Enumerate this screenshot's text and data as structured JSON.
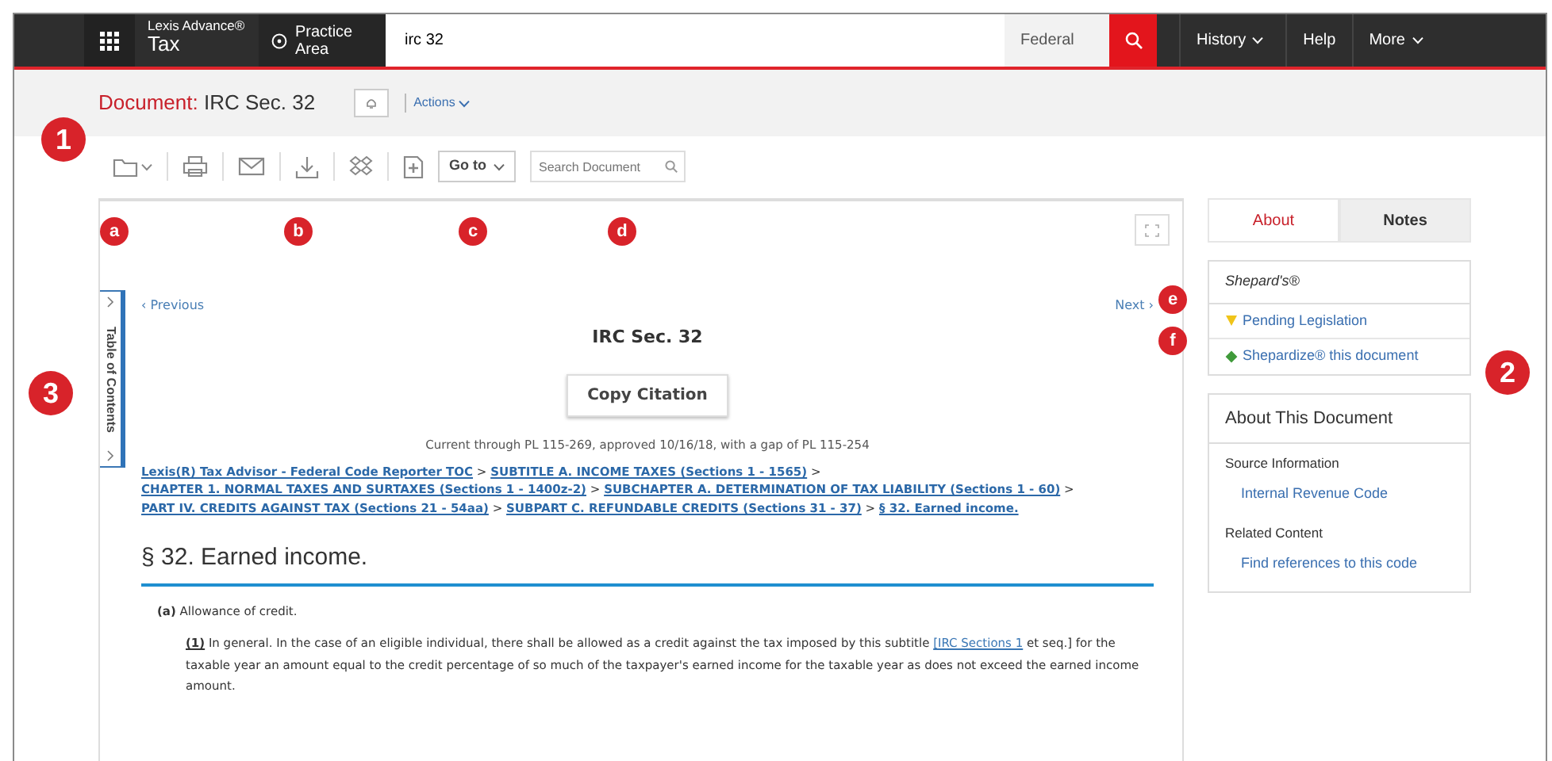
{
  "topbar": {
    "brand": {
      "line1": "Lexis Advance®",
      "line2": "Tax"
    },
    "practice_area": {
      "line1": "Practice",
      "line2": "Area"
    },
    "search": {
      "value": "irc 32"
    },
    "jurisdiction": "Federal",
    "nav": [
      {
        "label": "History",
        "dropdown": true
      },
      {
        "label": "Help",
        "dropdown": false
      },
      {
        "label": "More",
        "dropdown": true
      }
    ]
  },
  "document_header": {
    "label": "Document:",
    "title": "IRC Sec. 32",
    "actions": "Actions"
  },
  "toolbar": {
    "goto": "Go to",
    "search_placeholder": "Search Document"
  },
  "document": {
    "toc_label": "Table of Contents",
    "previous": "‹ Previous",
    "next": "Next ›",
    "title": "IRC Sec. 32",
    "copy_button": "Copy Citation",
    "currency": "Current through PL 115-269, approved 10/16/18, with a gap of PL 115-254",
    "breadcrumb_separator": ">",
    "breadcrumb": [
      "Lexis(R) Tax Advisor - Federal Code Reporter TOC",
      "SUBTITLE A. INCOME TAXES (Sections 1 - 1565)",
      "CHAPTER 1. NORMAL TAXES AND SURTAXES (Sections 1 - 1400z-2)",
      "SUBCHAPTER A. DETERMINATION OF TAX LIABILITY (Sections 1 - 60)",
      "PART IV. CREDITS AGAINST TAX (Sections 21 - 54aa)",
      "SUBPART C. REFUNDABLE CREDITS (Sections 31 - 37)",
      "§ 32. Earned income."
    ],
    "section_heading": "§ 32. Earned income.",
    "subsection": {
      "label": "(a)",
      "text": "Allowance of credit."
    },
    "paragraph": {
      "label": "(1)",
      "text_before": "In general. In the case of an eligible individual, there shall be allowed as a credit against the tax imposed by this subtitle ",
      "link": "[IRC Sections 1",
      "text_after": " et seq.] for the taxable year an amount equal to the credit percentage of so much of the taxpayer's earned income for the taxable year as does not exceed the earned income amount."
    }
  },
  "sidebar": {
    "tabs": [
      {
        "label": "About",
        "selected": true
      },
      {
        "label": "Notes",
        "selected": false
      }
    ],
    "shepards": {
      "title": "Shepard's®",
      "items": [
        {
          "label": "Pending Legislation",
          "kind": "caution",
          "color": "#f0c419"
        },
        {
          "label": "Shepardize® this document",
          "kind": "positive",
          "color": "#3f9a3a"
        }
      ]
    },
    "about": {
      "title": "About This Document",
      "sections": [
        {
          "heading": "Source Information",
          "link": "Internal Revenue Code"
        },
        {
          "heading": "Related Content",
          "link": "Find references to this code"
        }
      ]
    }
  },
  "callouts": [
    {
      "label": "1",
      "kind": "number"
    },
    {
      "label": "a",
      "kind": "letter"
    },
    {
      "label": "b",
      "kind": "letter"
    },
    {
      "label": "c",
      "kind": "letter"
    },
    {
      "label": "d",
      "kind": "letter"
    },
    {
      "label": "e",
      "kind": "letter"
    },
    {
      "label": "f",
      "kind": "letter"
    },
    {
      "label": "2",
      "kind": "number"
    },
    {
      "label": "3",
      "kind": "number"
    }
  ]
}
